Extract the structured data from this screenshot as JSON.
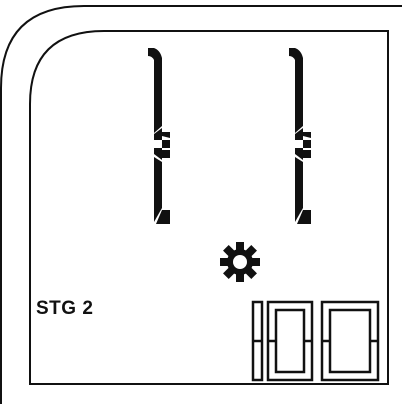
{
  "display": {
    "stage_label": "STG 2",
    "top_digits": [
      "1",
      "1"
    ],
    "bottom_value": "100",
    "settings_icon": "gear-icon",
    "segment_color": "#111111",
    "background_color": "#ffffff"
  }
}
